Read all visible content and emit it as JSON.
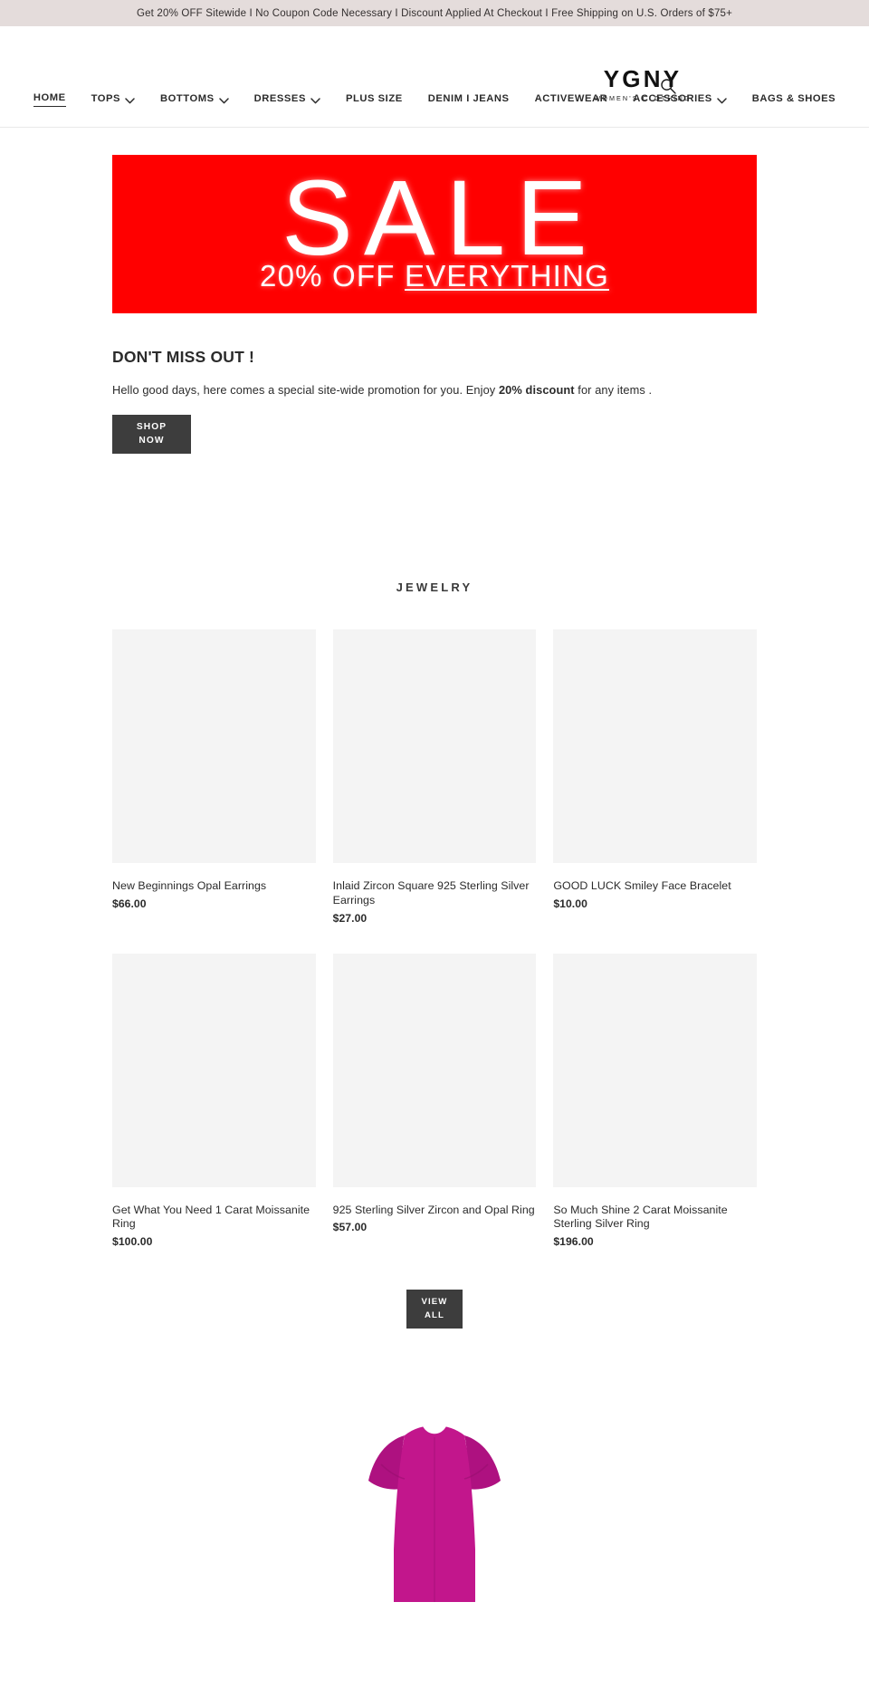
{
  "announcement": {
    "text": "Get 20% OFF Sitewide  I  No Coupon Code Necessary I  Discount Applied At Checkout  I  Free Shipping on U.S. Orders of $75+"
  },
  "header": {
    "logo_mark": "YGNY",
    "logo_tagline": "WOMEN'S CLOTHING",
    "search_icon": "search-icon"
  },
  "nav": {
    "items": [
      {
        "label": "HOME",
        "active": true,
        "caret": false
      },
      {
        "label": "TOPS",
        "active": false,
        "caret": true
      },
      {
        "label": "BOTTOMS",
        "active": false,
        "caret": true
      },
      {
        "label": "DRESSES",
        "active": false,
        "caret": true
      },
      {
        "label": "PLUS SIZE",
        "active": false,
        "caret": false
      },
      {
        "label": "DENIM I JEANS",
        "active": false,
        "caret": false
      },
      {
        "label": "ACTIVEWEAR",
        "active": false,
        "caret": false
      },
      {
        "label": "ACCESSORIES",
        "active": false,
        "caret": true
      },
      {
        "label": "BAGS & SHOES",
        "active": false,
        "caret": false
      }
    ]
  },
  "banner": {
    "headline": "SALE",
    "subline_plain": "20% OFF ",
    "subline_underlined": "EVERYTHING",
    "background_color": "#ff0000",
    "text_color": "#ffffff"
  },
  "promo": {
    "title": "DON'T MISS OUT !",
    "body_before": "Hello good days, here comes a special site-wide promotion for you. Enjoy ",
    "body_bold": "20% discount",
    "body_after": " for any items .",
    "cta_line1": "SHOP",
    "cta_line2": "NOW",
    "cta_color": "#3d3d3d"
  },
  "jewelry": {
    "title": "JEWELRY",
    "products": [
      {
        "title": "New Beginnings Opal Earrings",
        "price": "$66.00"
      },
      {
        "title": "Inlaid Zircon Square 925 Sterling Silver Earrings",
        "price": "$27.00"
      },
      {
        "title": "GOOD LUCK Smiley Face Bracelet",
        "price": "$10.00"
      },
      {
        "title": "Get What You Need 1 Carat Moissanite Ring",
        "price": "$100.00"
      },
      {
        "title": "925 Sterling Silver Zircon and Opal Ring",
        "price": "$57.00"
      },
      {
        "title": "So Much Shine 2 Carat Moissanite Sterling Silver Ring",
        "price": "$196.00"
      }
    ],
    "view_all_line1": "VIEW",
    "view_all_line2": "ALL"
  },
  "feature": {
    "dress_color": "#c2168c",
    "dress_shadow": "#8f0f68"
  }
}
